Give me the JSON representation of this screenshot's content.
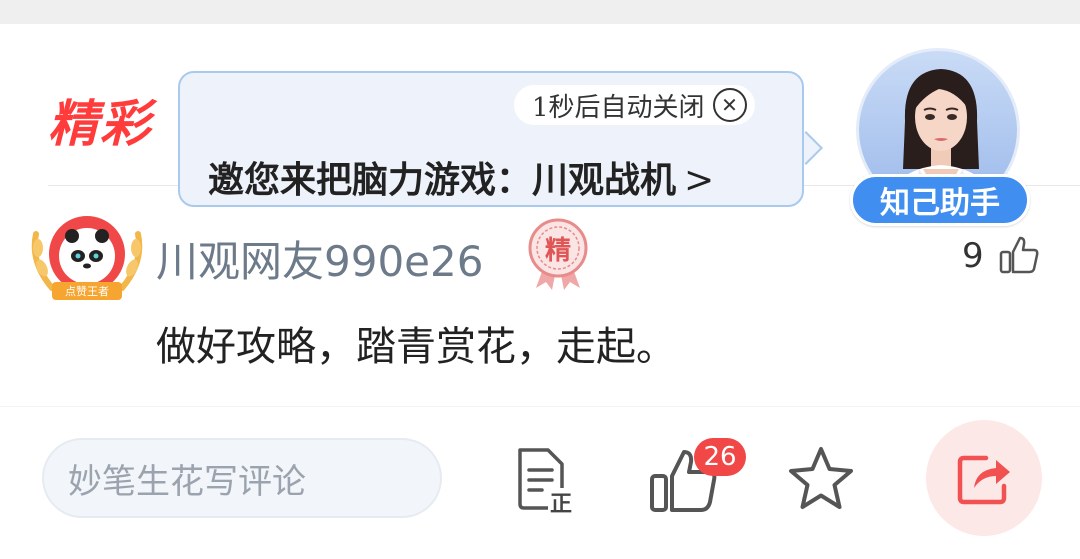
{
  "section": {
    "title": "精彩"
  },
  "popup": {
    "timer_text": "1秒后自动关闭",
    "link_text": "邀您来把脑力游戏：川观战机",
    "chevron": ">"
  },
  "assistant": {
    "badge_label": "知己助手"
  },
  "comment": {
    "username": "川观网友990e26",
    "avatar_caption": "点赞王者",
    "badge_text": "精",
    "like_count": "9",
    "text": "做好攻略，踏青赏花，走起。"
  },
  "bottom_bar": {
    "input_placeholder": "妙笔生花写评论",
    "doc_badge": "正",
    "like_badge_count": "26"
  },
  "colors": {
    "title_red": "#ff3b3b",
    "assistant_blue": "#3f8ef0",
    "badge_red": "#f14747",
    "share_bg": "#fde8e8",
    "share_red": "#f25151"
  }
}
